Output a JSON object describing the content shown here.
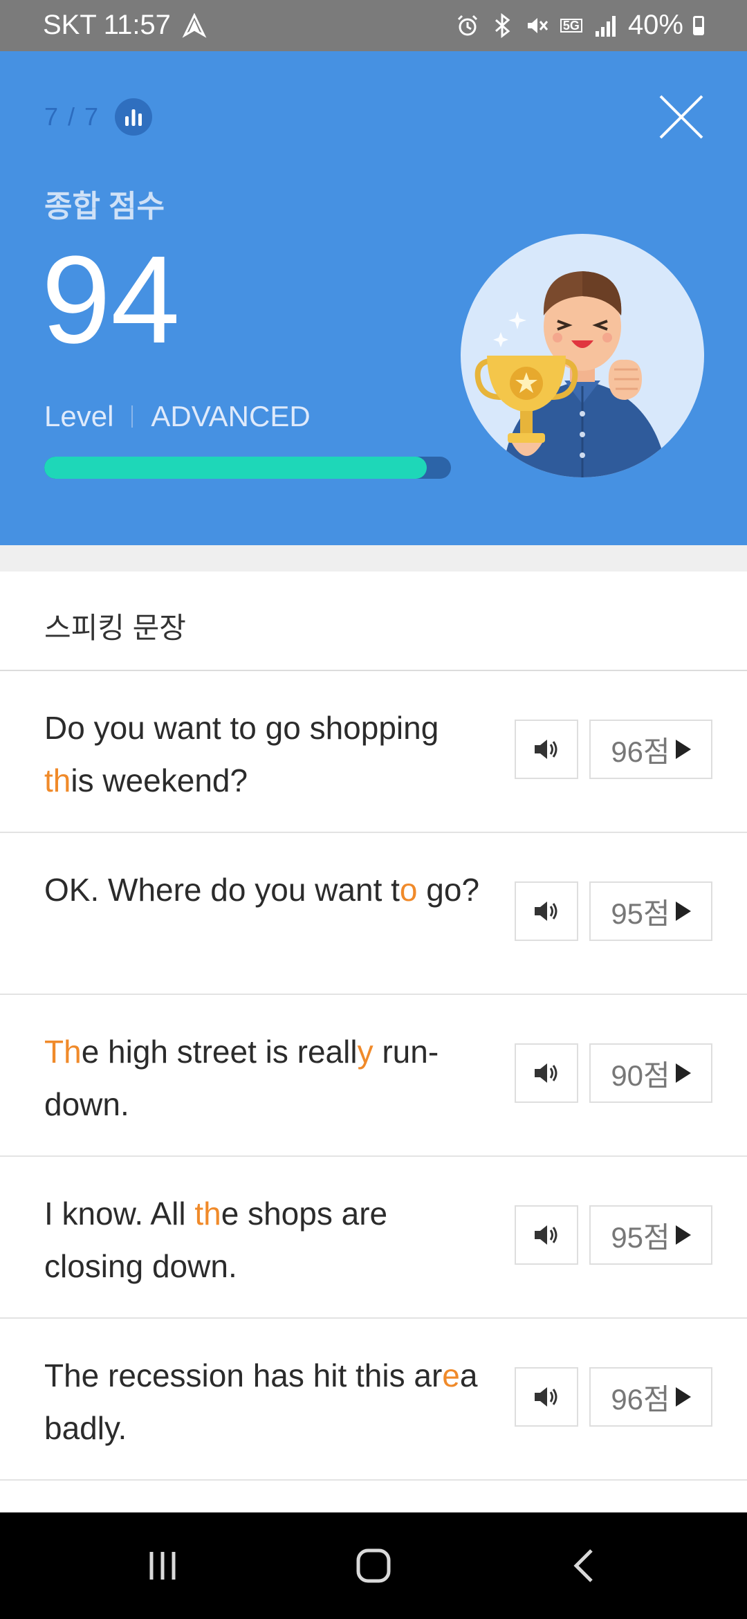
{
  "status_bar": {
    "carrier": "SKT",
    "time": "11:57",
    "network": "5G",
    "battery": "40%"
  },
  "hero": {
    "progress": "7 / 7",
    "score_label": "종합 점수",
    "score": "94",
    "level_label": "Level",
    "level_value": "ADVANCED",
    "level_progress": 0.94,
    "colors": {
      "background": "#4691e2",
      "bar_fill": "#1ed7b8",
      "bar_track": "#2c64a8"
    }
  },
  "section": {
    "title": "스피킹 문장"
  },
  "sentences": [
    {
      "parts": [
        {
          "t": "Do you want to go shopping "
        },
        {
          "t": "th",
          "h": true
        },
        {
          "t": "is weekend?"
        }
      ],
      "score": "96점"
    },
    {
      "parts": [
        {
          "t": "OK. Where do you want t"
        },
        {
          "t": "o",
          "h": true
        },
        {
          "t": " go?"
        }
      ],
      "score": "95점"
    },
    {
      "parts": [
        {
          "t": "Th",
          "h": true
        },
        {
          "t": "e high street is reall"
        },
        {
          "t": "y",
          "h": true
        },
        {
          "t": " run-down."
        }
      ],
      "score": "90점"
    },
    {
      "parts": [
        {
          "t": "I know. All "
        },
        {
          "t": "th",
          "h": true
        },
        {
          "t": "e shops are closing down."
        }
      ],
      "score": "95점"
    },
    {
      "parts": [
        {
          "t": "The recession has hit this ar"
        },
        {
          "t": "e",
          "h": true
        },
        {
          "t": "a badly."
        }
      ],
      "score": "96점"
    }
  ],
  "icons": {
    "stats": "bar-chart-icon",
    "close": "close-icon",
    "audio": "speaker-icon",
    "play": "play-icon",
    "nav_recents": "recents-icon",
    "nav_home": "home-icon",
    "nav_back": "back-icon"
  },
  "highlight_color": "#f08a2a"
}
